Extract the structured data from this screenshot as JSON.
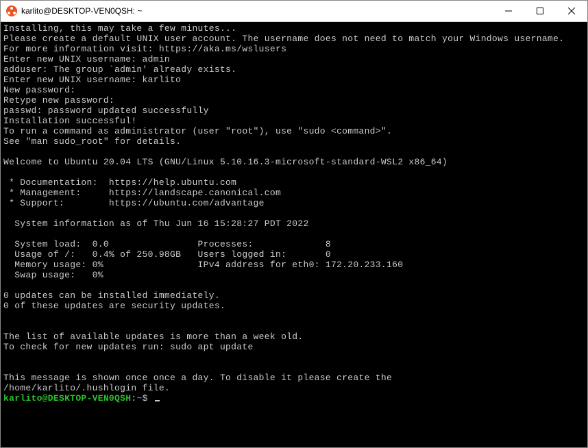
{
  "window": {
    "title": "karlito@DESKTOP-VEN0QSH: ~"
  },
  "terminal": {
    "lines": {
      "l1": "Installing, this may take a few minutes...",
      "l2": "Please create a default UNIX user account. The username does not need to match your Windows username.",
      "l3": "For more information visit: https://aka.ms/wslusers",
      "l4": "Enter new UNIX username: admin",
      "l5": "adduser: The group `admin' already exists.",
      "l6": "Enter new UNIX username: karlito",
      "l7": "New password:",
      "l8": "Retype new password:",
      "l9": "passwd: password updated successfully",
      "l10": "Installation successful!",
      "l11": "To run a command as administrator (user \"root\"), use \"sudo <command>\".",
      "l12": "See \"man sudo_root\" for details.",
      "l13": "",
      "l14": "Welcome to Ubuntu 20.04 LTS (GNU/Linux 5.10.16.3-microsoft-standard-WSL2 x86_64)",
      "l15": "",
      "l16": " * Documentation:  https://help.ubuntu.com",
      "l17": " * Management:     https://landscape.canonical.com",
      "l18": " * Support:        https://ubuntu.com/advantage",
      "l19": "",
      "l20": "  System information as of Thu Jun 16 15:28:27 PDT 2022",
      "l21": "",
      "l22": "  System load:  0.0                Processes:             8",
      "l23": "  Usage of /:   0.4% of 250.98GB   Users logged in:       0",
      "l24": "  Memory usage: 0%                 IPv4 address for eth0: 172.20.233.160",
      "l25": "  Swap usage:   0%",
      "l26": "",
      "l27": "0 updates can be installed immediately.",
      "l28": "0 of these updates are security updates.",
      "l29": "",
      "l30": "",
      "l31": "The list of available updates is more than a week old.",
      "l32": "To check for new updates run: sudo apt update",
      "l33": "",
      "l34": "",
      "l35": "This message is shown once once a day. To disable it please create the",
      "l36": "/home/karlito/.hushlogin file."
    },
    "prompt": {
      "userhost": "karlito@DESKTOP-VEN0QSH",
      "sep": ":",
      "path": "~",
      "suffix": "$ "
    }
  }
}
